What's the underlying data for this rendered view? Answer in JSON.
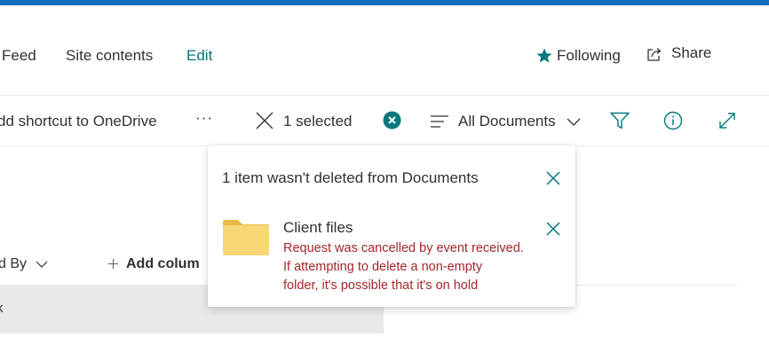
{
  "nav": {
    "feed_label": "Feed",
    "site_contents_label": "Site contents",
    "edit_label": "Edit",
    "following_label": "Following",
    "share_label": "Share"
  },
  "icons": {
    "following": "star-icon",
    "share": "share-icon",
    "more": "more-icon",
    "clear_selection": "close-icon",
    "selection_badge": "close-circle-icon",
    "view": "list-icon",
    "view_chevron": "chevron-down-icon",
    "filter": "filter-icon",
    "info": "info-icon",
    "expand": "expand-icon",
    "folder": "folder-icon"
  },
  "command_bar": {
    "add_shortcut_label": "dd shortcut to OneDrive",
    "more_label": "···",
    "selected_label": "1 selected",
    "view_label": "All Documents"
  },
  "list": {
    "modified_by_label": "d By",
    "add_column_label": "Add colum",
    "row_fragment": "k"
  },
  "callout": {
    "title": "1 item wasn't deleted from Documents",
    "item": {
      "name": "Client files",
      "error_lines": [
        "Request was cancelled by event received.",
        "If attempting to delete a non-empty",
        "folder, it's possible that it's on hold"
      ]
    }
  },
  "colors": {
    "accent_teal": "#03787c",
    "top_bar": "#0f6cbd",
    "error_red": "#a4262c",
    "folder_yellow": "#f9d776",
    "row_gray": "#ebe9e7"
  }
}
